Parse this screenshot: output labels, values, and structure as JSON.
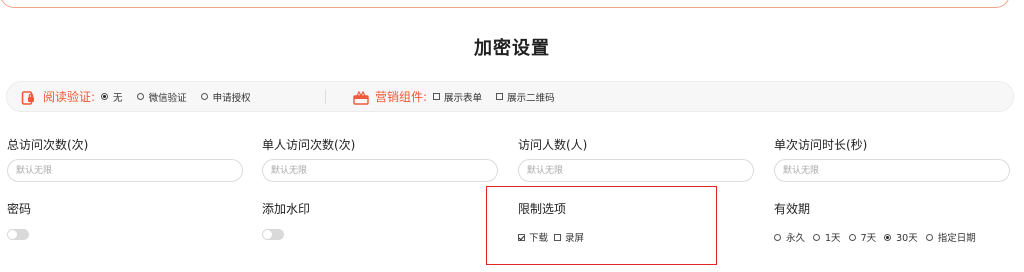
{
  "title": "加密设置",
  "settings_bar": {
    "read_verify": {
      "label": "阅读验证:",
      "options": [
        "无",
        "微信验证",
        "申请授权"
      ],
      "selected": "无"
    },
    "marketing": {
      "label": "营销组件:",
      "options": [
        "展示表单",
        "展示二维码"
      ]
    }
  },
  "fields": {
    "total_visits": {
      "label": "总访问次数(次)",
      "placeholder": "默认无限"
    },
    "single_visits": {
      "label": "单人访问次数(次)",
      "placeholder": "默认无限"
    },
    "visitor_count": {
      "label": "访问人数(人)",
      "placeholder": "默认无限"
    },
    "single_duration": {
      "label": "单次访问时长(秒)",
      "placeholder": "默认无限"
    }
  },
  "password": {
    "label": "密码",
    "enabled": false
  },
  "watermark": {
    "label": "添加水印",
    "enabled": false
  },
  "restrictions": {
    "label": "限制选项",
    "options": [
      {
        "label": "下载",
        "checked": true
      },
      {
        "label": "录屏",
        "checked": false
      }
    ]
  },
  "validity": {
    "label": "有效期",
    "options": [
      "永久",
      "1天",
      "7天",
      "30天",
      "指定日期"
    ],
    "selected": "30天"
  },
  "colors": {
    "accent": "#f05a3a",
    "highlight_border": "#e0262a",
    "toggle_off": "#d9d9d9"
  }
}
